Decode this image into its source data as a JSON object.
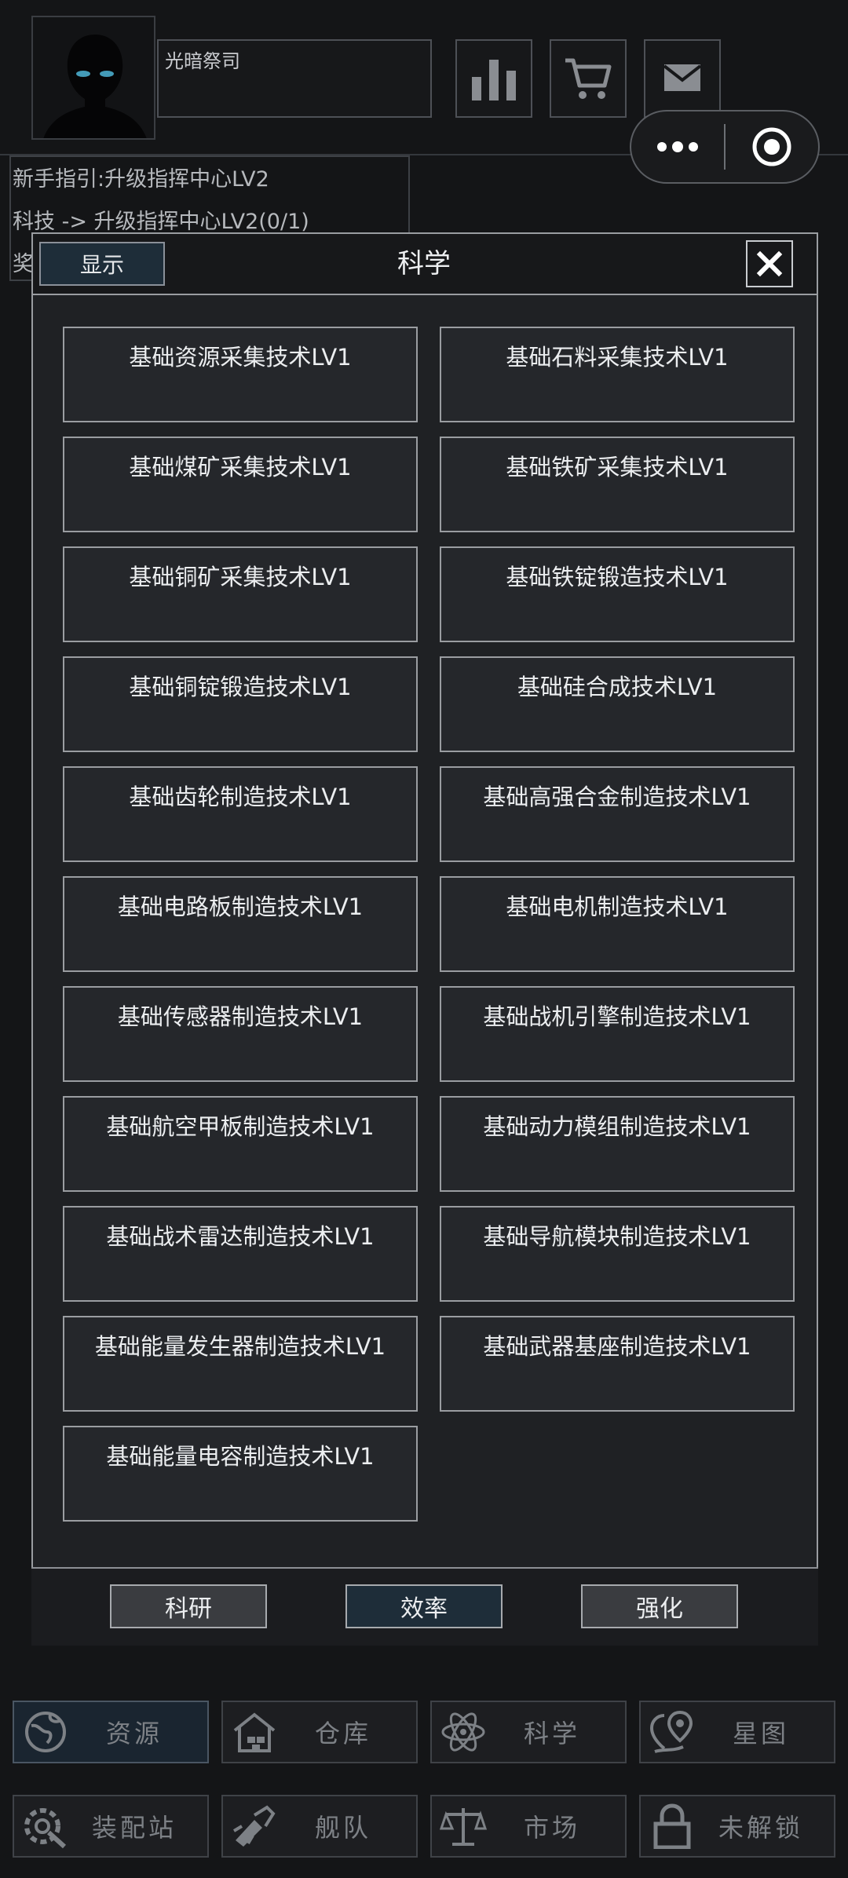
{
  "profile": {
    "name": "光暗祭司"
  },
  "guide": {
    "line1": "新手指引:升级指挥中心LV2",
    "line2": "科技 -> 升级指挥中心LV2(0/1)",
    "line3": "奖"
  },
  "modal": {
    "toggle_label": "显示",
    "title": "科学",
    "close_icon": "close-icon",
    "techs": [
      "基础资源采集技术LV1",
      "基础石料采集技术LV1",
      "基础煤矿采集技术LV1",
      "基础铁矿采集技术LV1",
      "基础铜矿采集技术LV1",
      "基础铁锭锻造技术LV1",
      "基础铜锭锻造技术LV1",
      "基础硅合成技术LV1",
      "基础齿轮制造技术LV1",
      "基础高强合金制造技术LV1",
      "基础电路板制造技术LV1",
      "基础电机制造技术LV1",
      "基础传感器制造技术LV1",
      "基础战机引擎制造技术LV1",
      "基础航空甲板制造技术LV1",
      "基础动力模组制造技术LV1",
      "基础战术雷达制造技术LV1",
      "基础导航模块制造技术LV1",
      "基础能量发生器制造技术LV1",
      "基础武器基座制造技术LV1",
      "基础能量电容制造技术LV1"
    ],
    "footer": {
      "research_label": "科研",
      "efficiency_label": "效率",
      "enhance_label": "强化",
      "active": "效率"
    }
  },
  "nav": {
    "row1": [
      "资源",
      "仓库",
      "科学",
      "星图"
    ],
    "row2": [
      "装配站",
      "舰队",
      "市场",
      "未解锁"
    ],
    "active": "资源"
  },
  "colors": {
    "background": "#141517",
    "active_blue": "#1e2d39",
    "card": "#25272b",
    "border": "#9a9da1"
  }
}
